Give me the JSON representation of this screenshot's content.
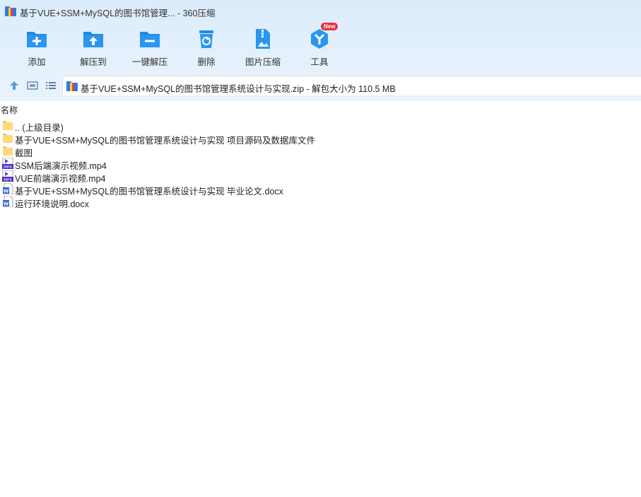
{
  "window": {
    "title": "基于VUE+SSM+MySQL的图书馆管理... - 360压缩"
  },
  "toolbar": {
    "items": [
      {
        "label": "添加",
        "icon": "add-icon"
      },
      {
        "label": "解压到",
        "icon": "extract-to-icon"
      },
      {
        "label": "一键解压",
        "icon": "one-click-extract-icon"
      },
      {
        "label": "删除",
        "icon": "delete-icon"
      },
      {
        "label": "图片压缩",
        "icon": "image-compress-icon"
      },
      {
        "label": "工具",
        "icon": "tools-icon",
        "badge": "New"
      }
    ]
  },
  "address": {
    "text": "基于VUE+SSM+MySQL的图书馆管理系统设计与实现.zip - 解包大小为 110.5 MB"
  },
  "list": {
    "column_name": "名称",
    "rows": [
      {
        "name": ".. (上级目录)",
        "type": "folder"
      },
      {
        "name": "基于VUE+SSM+MySQL的图书馆管理系统设计与实现 项目源码及数据库文件",
        "type": "folder"
      },
      {
        "name": "截图",
        "type": "folder"
      },
      {
        "name": "SSM后端演示视频.mp4",
        "type": "mp4"
      },
      {
        "name": "VUE前端演示视频.mp4",
        "type": "mp4"
      },
      {
        "name": "基于VUE+SSM+MySQL的图书馆管理系统设计与实现 毕业论文.docx",
        "type": "docx"
      },
      {
        "name": "运行环境说明.docx",
        "type": "docx"
      }
    ]
  },
  "colors": {
    "accent": "#1e88e5",
    "folder": "#ffd56b",
    "mp4": "#5b3fd6",
    "docx": "#2b5fd9",
    "badge": "#e8323c"
  }
}
